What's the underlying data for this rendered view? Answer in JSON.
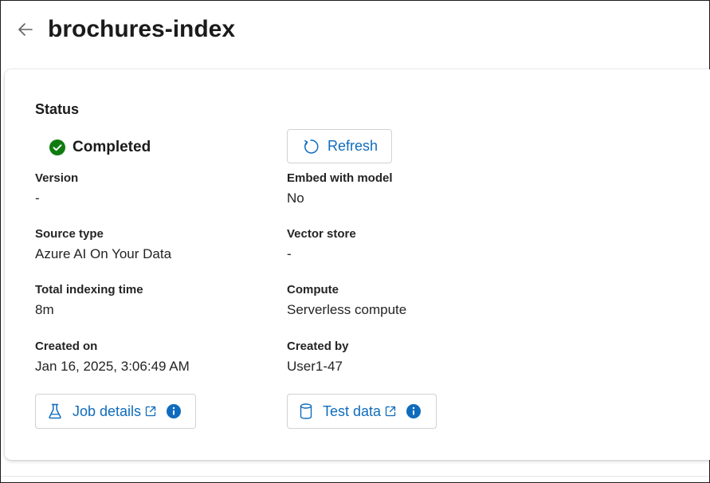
{
  "header": {
    "title": "brochures-index"
  },
  "status_section": {
    "title": "Status",
    "status": "Completed",
    "refresh_label": "Refresh"
  },
  "fields": {
    "version": {
      "label": "Version",
      "value": "-"
    },
    "embed_model": {
      "label": "Embed with model",
      "value": "No"
    },
    "source_type": {
      "label": "Source type",
      "value": "Azure AI On Your Data"
    },
    "vector_store": {
      "label": "Vector store",
      "value": "-"
    },
    "indexing_time": {
      "label": "Total indexing time",
      "value": "8m"
    },
    "compute": {
      "label": "Compute",
      "value": "Serverless compute"
    },
    "created_on": {
      "label": "Created on",
      "value": "Jan 16, 2025, 3:06:49 AM"
    },
    "created_by": {
      "label": "Created by",
      "value": "User1-47"
    }
  },
  "links": {
    "job_details": "Job details",
    "test_data": "Test data"
  },
  "icons": {
    "back": "arrow-left-icon",
    "status": "check-circle-icon",
    "refresh": "refresh-icon",
    "job": "beaker-icon",
    "test_data": "database-icon",
    "external": "external-link-icon",
    "info": "info-icon"
  },
  "colors": {
    "accent": "#0f6cbd",
    "success": "#107c10",
    "text": "#242424",
    "border": "#d1d1d1"
  }
}
